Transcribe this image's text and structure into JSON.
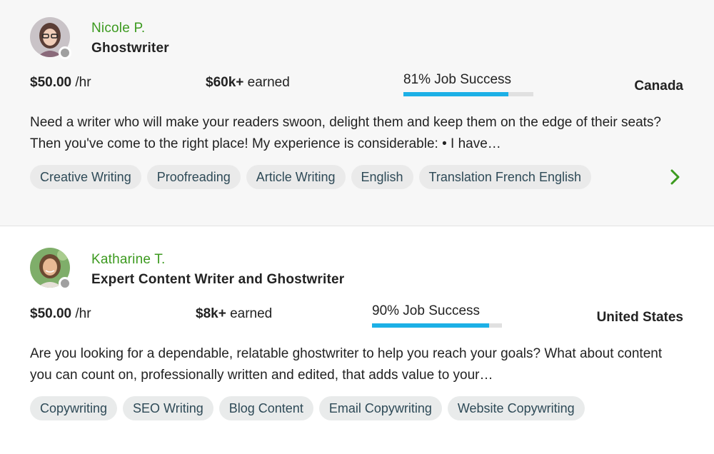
{
  "freelancers": [
    {
      "name": "Nicole P.",
      "title": "Ghostwriter",
      "rate": "$50.00",
      "rate_unit": "/hr",
      "earned_amount": "$60k+",
      "earned_label": "earned",
      "job_success_label": "81% Job Success",
      "job_success_pct": 81,
      "country": "Canada",
      "description": "Need a writer who will make your readers swoon, delight them and keep them on the edge of their seats? Then you've come to the right place! My experience is considerable: • I have…",
      "skills": [
        "Creative Writing",
        "Proofreading",
        "Article Writing",
        "English",
        "Translation French English"
      ]
    },
    {
      "name": "Katharine T.",
      "title": "Expert Content Writer and Ghostwriter",
      "rate": "$50.00",
      "rate_unit": "/hr",
      "earned_amount": "$8k+",
      "earned_label": "earned",
      "job_success_label": "90% Job Success",
      "job_success_pct": 90,
      "country": "United States",
      "description": "Are you looking for a dependable, relatable ghostwriter to help you reach your goals? What about content you can count on, professionally written and edited, that adds value to your…",
      "skills": [
        "Copywriting",
        "SEO Writing",
        "Blog Content",
        "Email Copywriting",
        "Website Copywriting"
      ]
    }
  ],
  "colors": {
    "name": "#3c9a1f",
    "progress": "#1cb0e6",
    "chevron": "#3c9a1f"
  },
  "icons": {
    "next": "chevron-right-icon",
    "status": "status-dot-icon"
  }
}
